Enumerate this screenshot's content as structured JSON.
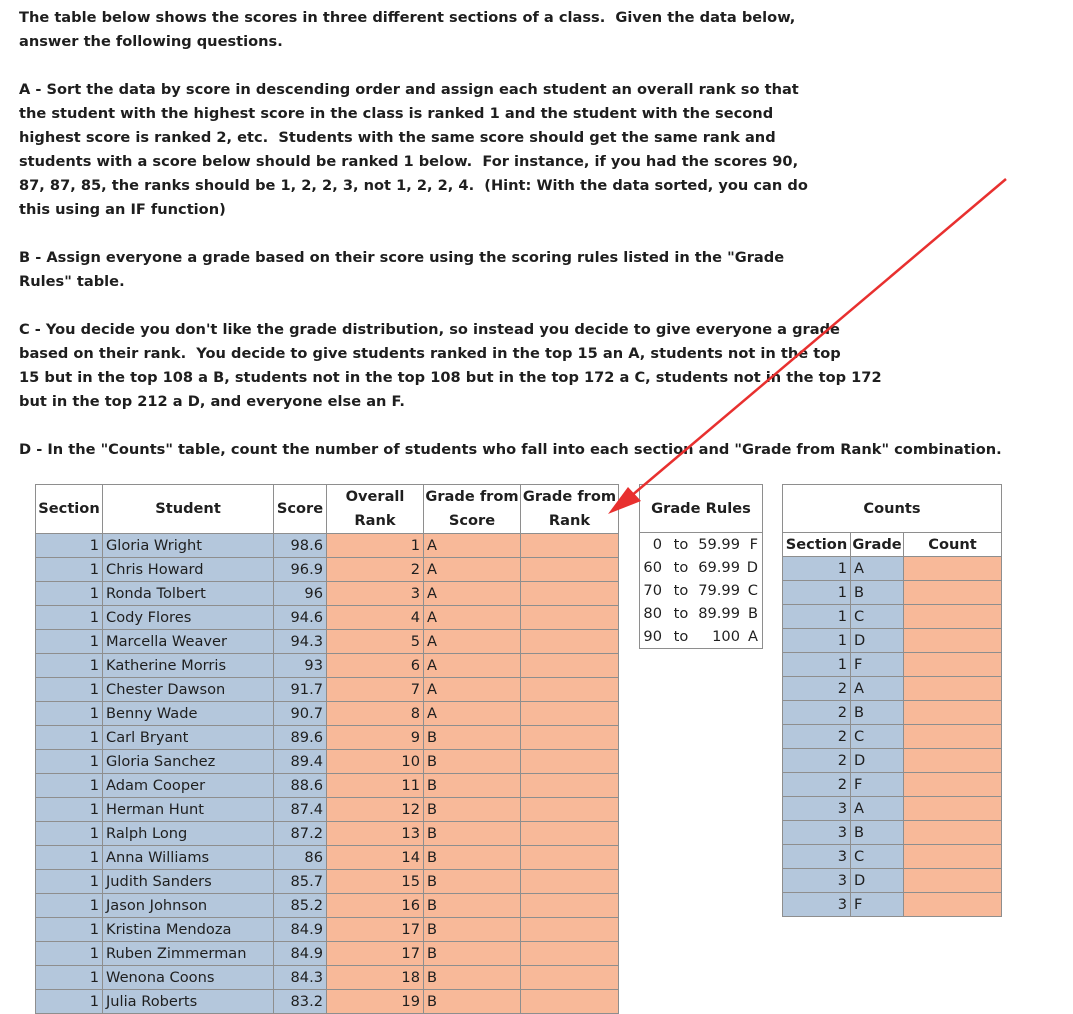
{
  "instructions": [
    "The table below shows the scores in three different sections of a class.  Given the data below,\nanswer the following questions.",
    "A - Sort the data by score in descending order and assign each student an overall rank so that\nthe student with the highest score in the class is ranked 1 and the student with the second\nhighest score is ranked 2, etc.  Students with the same score should get the same rank and\nstudents with a score below should be ranked 1 below.  For instance, if you had the scores 90,\n87, 87, 85, the ranks should be 1, 2, 2, 3, not 1, 2, 2, 4.  (Hint: With the data sorted, you can do\nthis using an IF function)",
    "B - Assign everyone a grade based on their score using the scoring rules listed in the \"Grade\nRules\" table.",
    "C - You decide you don't like the grade distribution, so instead you decide to give everyone a grade\nbased on their rank.  You decide to give students ranked in the top 15 an A, students not in the top\n15 but in the top 108 a B, students not in the top 108 but in the top 172 a C, students not in the top 172\nbut in the top 212 a D, and everyone else an F.",
    "D - In the \"Counts\" table, count the number of students who fall into each section and \"Grade from Rank\" combination."
  ],
  "main_table": {
    "headers": {
      "section": "Section",
      "student": "Student",
      "score": "Score",
      "overall_rank": [
        "Overall",
        "Rank"
      ],
      "grade_from_score": [
        "Grade from",
        "Score"
      ],
      "grade_from_rank": [
        "Grade from",
        "Rank"
      ]
    },
    "rows": [
      {
        "section": "1",
        "student": "Gloria Wright",
        "score": "98.6",
        "rank": "1",
        "grade": "A"
      },
      {
        "section": "1",
        "student": "Chris Howard",
        "score": "96.9",
        "rank": "2",
        "grade": "A"
      },
      {
        "section": "1",
        "student": "Ronda Tolbert",
        "score": "96",
        "rank": "3",
        "grade": "A"
      },
      {
        "section": "1",
        "student": "Cody Flores",
        "score": "94.6",
        "rank": "4",
        "grade": "A"
      },
      {
        "section": "1",
        "student": "Marcella Weaver",
        "score": "94.3",
        "rank": "5",
        "grade": "A"
      },
      {
        "section": "1",
        "student": "Katherine Morris",
        "score": "93",
        "rank": "6",
        "grade": "A"
      },
      {
        "section": "1",
        "student": "Chester Dawson",
        "score": "91.7",
        "rank": "7",
        "grade": "A"
      },
      {
        "section": "1",
        "student": "Benny Wade",
        "score": "90.7",
        "rank": "8",
        "grade": "A"
      },
      {
        "section": "1",
        "student": "Carl Bryant",
        "score": "89.6",
        "rank": "9",
        "grade": "B"
      },
      {
        "section": "1",
        "student": "Gloria Sanchez",
        "score": "89.4",
        "rank": "10",
        "grade": "B"
      },
      {
        "section": "1",
        "student": "Adam Cooper",
        "score": "88.6",
        "rank": "11",
        "grade": "B"
      },
      {
        "section": "1",
        "student": "Herman Hunt",
        "score": "87.4",
        "rank": "12",
        "grade": "B"
      },
      {
        "section": "1",
        "student": "Ralph Long",
        "score": "87.2",
        "rank": "13",
        "grade": "B"
      },
      {
        "section": "1",
        "student": "Anna Williams",
        "score": "86",
        "rank": "14",
        "grade": "B"
      },
      {
        "section": "1",
        "student": "Judith Sanders",
        "score": "85.7",
        "rank": "15",
        "grade": "B"
      },
      {
        "section": "1",
        "student": "Jason Johnson",
        "score": "85.2",
        "rank": "16",
        "grade": "B"
      },
      {
        "section": "1",
        "student": "Kristina Mendoza",
        "score": "84.9",
        "rank": "17",
        "grade": "B"
      },
      {
        "section": "1",
        "student": "Ruben Zimmerman",
        "score": "84.9",
        "rank": "17",
        "grade": "B"
      },
      {
        "section": "1",
        "student": "Wenona Coons",
        "score": "84.3",
        "rank": "18",
        "grade": "B"
      },
      {
        "section": "1",
        "student": "Julia Roberts",
        "score": "83.2",
        "rank": "19",
        "grade": "B"
      }
    ]
  },
  "grade_rules": {
    "title": "Grade Rules",
    "rows": [
      {
        "low": "0",
        "to": "to",
        "high": "59.99",
        "grade": "F"
      },
      {
        "low": "60",
        "to": "to",
        "high": "69.99",
        "grade": "D"
      },
      {
        "low": "70",
        "to": "to",
        "high": "79.99",
        "grade": "C"
      },
      {
        "low": "80",
        "to": "to",
        "high": "89.99",
        "grade": "B"
      },
      {
        "low": "90",
        "to": "to",
        "high": "100",
        "grade": "A"
      }
    ]
  },
  "counts": {
    "title": "Counts",
    "headers": {
      "section": "Section",
      "grade": "Grade",
      "count": "Count"
    },
    "rows": [
      {
        "section": "1",
        "grade": "A"
      },
      {
        "section": "1",
        "grade": "B"
      },
      {
        "section": "1",
        "grade": "C"
      },
      {
        "section": "1",
        "grade": "D"
      },
      {
        "section": "1",
        "grade": "F"
      },
      {
        "section": "2",
        "grade": "A"
      },
      {
        "section": "2",
        "grade": "B"
      },
      {
        "section": "2",
        "grade": "C"
      },
      {
        "section": "2",
        "grade": "D"
      },
      {
        "section": "2",
        "grade": "F"
      },
      {
        "section": "3",
        "grade": "A"
      },
      {
        "section": "3",
        "grade": "B"
      },
      {
        "section": "3",
        "grade": "C"
      },
      {
        "section": "3",
        "grade": "D"
      },
      {
        "section": "3",
        "grade": "F"
      }
    ]
  },
  "colors": {
    "input_fill": "#b4c7dc",
    "output_fill": "#f8b999",
    "arrow": "#e8302f"
  }
}
